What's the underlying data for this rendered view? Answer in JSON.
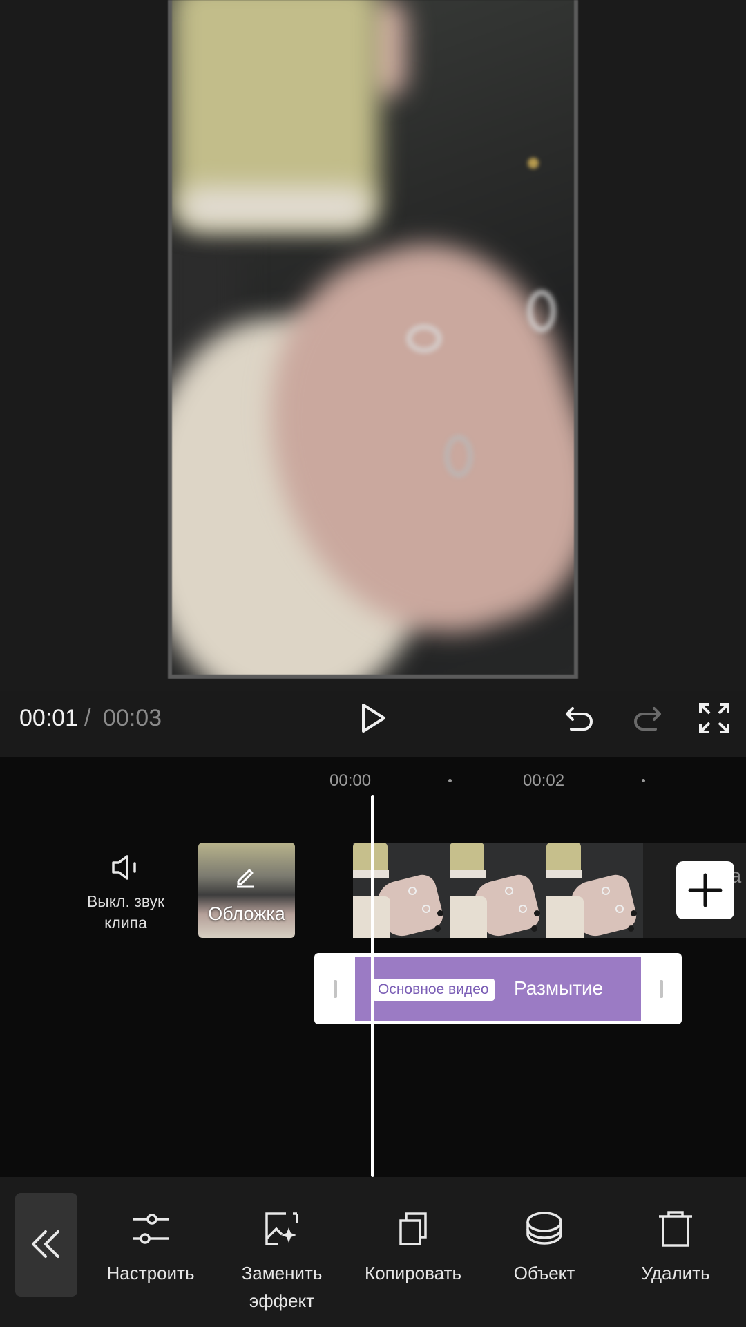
{
  "player": {
    "current_time": "00:01",
    "separator": "/",
    "total_time": "00:03"
  },
  "timeline": {
    "ticks": [
      "00:00",
      "00:02"
    ],
    "mute_label": "Выкл. звук\nклипа",
    "cover_label": "Обложка",
    "tail_text": "ба\nц",
    "effect": {
      "badge": "Основное видео",
      "name": "Размытие",
      "color": "#9b7bc4"
    }
  },
  "toolbar": {
    "tools": [
      {
        "label": "Настроить"
      },
      {
        "label": "Заменить\nэффект"
      },
      {
        "label": "Копировать"
      },
      {
        "label": "Объект"
      },
      {
        "label": "Удалить"
      }
    ]
  }
}
